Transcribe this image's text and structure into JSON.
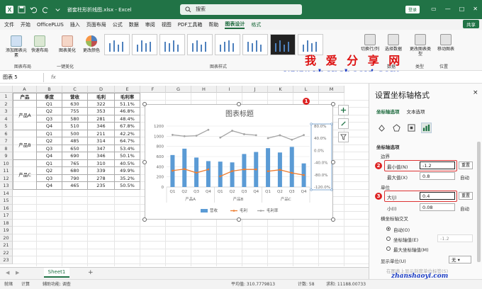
{
  "window": {
    "title": "嵌套柱形折线图.xlsx - Excel",
    "search_placeholder": "搜索",
    "login_label": "登录",
    "share_label": "共享"
  },
  "tabs": [
    "文件",
    "开始",
    "OfficePLUS",
    "插入",
    "页面布局",
    "公式",
    "数据",
    "审阅",
    "视图",
    "PDF工具箱",
    "帮助",
    "图表设计",
    "格式"
  ],
  "ribbon": {
    "add_element": "添加图表元素",
    "quick_layout": "快速布局",
    "group_layout": "图表布局",
    "beautify": "图表美化",
    "group_beautify": "一键美化",
    "change_colors": "更改颜色",
    "group_styles": "图表样式",
    "switch_rowcol": "切换行/列",
    "select_data": "选择数据",
    "group_data": "数据",
    "change_type": "更改图表类型",
    "group_type": "类型",
    "move_chart": "移动图表",
    "group_location": "位置"
  },
  "watermark": {
    "top": "我 爱 分 享 网",
    "url": "www.zhanshaoyi.com",
    "bottom": "zhanshaoyi.com"
  },
  "formula_bar": {
    "name_box": "图表 5",
    "fx": "fx"
  },
  "sheet": {
    "col_headers": [
      "A",
      "B",
      "C",
      "D",
      "E",
      "F",
      "G",
      "H",
      "I",
      "J",
      "K",
      "L",
      "M"
    ],
    "header_row": [
      "产品",
      "季度",
      "营收",
      "毛利",
      "毛利率"
    ],
    "groups": [
      {
        "product": "产品A",
        "rows": [
          [
            "Q1",
            "630",
            "322",
            "51.1%"
          ],
          [
            "Q2",
            "755",
            "353",
            "46.8%"
          ],
          [
            "Q3",
            "580",
            "281",
            "48.4%"
          ],
          [
            "Q4",
            "510",
            "346",
            "67.8%"
          ]
        ]
      },
      {
        "product": "产品B",
        "rows": [
          [
            "Q1",
            "500",
            "211",
            "42.2%"
          ],
          [
            "Q2",
            "485",
            "314",
            "64.7%"
          ],
          [
            "Q3",
            "650",
            "347",
            "53.4%"
          ],
          [
            "Q4",
            "690",
            "346",
            "50.1%"
          ]
        ]
      },
      {
        "product": "产品C",
        "rows": [
          [
            "Q1",
            "765",
            "310",
            "40.5%"
          ],
          [
            "Q2",
            "680",
            "339",
            "49.9%"
          ],
          [
            "Q3",
            "790",
            "278",
            "35.2%"
          ],
          [
            "Q4",
            "465",
            "235",
            "50.5%"
          ]
        ]
      }
    ],
    "sheet_tab": "Sheet1",
    "add_sheet": "+"
  },
  "chart_data": {
    "type": "bar",
    "title": "图表标题",
    "categories": [
      "Q1",
      "Q2",
      "Q3",
      "Q4",
      "Q1",
      "Q2",
      "Q3",
      "Q4",
      "Q1",
      "Q2",
      "Q3",
      "Q4"
    ],
    "groups": [
      "产品A",
      "产品B",
      "产品C"
    ],
    "series": [
      {
        "name": "营收",
        "type": "bar",
        "axis": "left",
        "color": "#5b9bd5",
        "values": [
          630,
          755,
          580,
          510,
          500,
          485,
          650,
          690,
          765,
          680,
          790,
          465
        ]
      },
      {
        "name": "毛利",
        "type": "line",
        "axis": "left",
        "color": "#ed7d31",
        "values": [
          322,
          353,
          281,
          346,
          211,
          314,
          347,
          346,
          310,
          339,
          278,
          235
        ]
      },
      {
        "name": "毛利率",
        "type": "line",
        "axis": "right",
        "color": "#a5a5a5",
        "values": [
          51.1,
          46.8,
          48.4,
          67.8,
          42.2,
          64.7,
          53.4,
          50.1,
          40.5,
          49.9,
          35.2,
          50.5
        ]
      }
    ],
    "y_left": {
      "ylim": [
        0,
        1200
      ],
      "ticks": [
        "1200",
        "1000",
        "800",
        "600",
        "400",
        "200",
        "0"
      ]
    },
    "y_right": {
      "ylim": [
        -120,
        80
      ],
      "ticks": [
        "80.0%",
        "40.0%",
        "0.0%",
        "-40.0%",
        "-80.0%",
        "-120.0%"
      ]
    },
    "legend": "bottom"
  },
  "panel": {
    "title": "设置坐标轴格式",
    "close": "×",
    "tab_axis": "坐标轴选项",
    "tab_text": "文本选项",
    "section": "坐标轴选项",
    "bounds": "边界",
    "min_label": "最小值(N)",
    "min_value": "-1.2",
    "max_label": "最大值(X)",
    "max_value": "0.8",
    "reset": "重置",
    "auto": "自动",
    "units": "单位",
    "major_label": "大(J)",
    "major_value": "0.4",
    "minor_label": "小(I)",
    "minor_value": "0.08",
    "cross": "横坐标轴交叉",
    "opt_auto": "自动(O)",
    "opt_value": "坐标轴值(E)",
    "opt_value_num": "-1.2",
    "opt_max": "最大坐标轴值(M)",
    "display_unit": "显示单位(U)",
    "display_unit_value": "无",
    "show_label": "在图表上显示刻度单位标签(S)"
  },
  "status": {
    "ready": "就绪",
    "calc": "计算",
    "accessibility": "辅助功能: 调查",
    "average": "平均值: 310.7779813",
    "count": "计数: 58",
    "sum": "求和: 11188.00733"
  }
}
